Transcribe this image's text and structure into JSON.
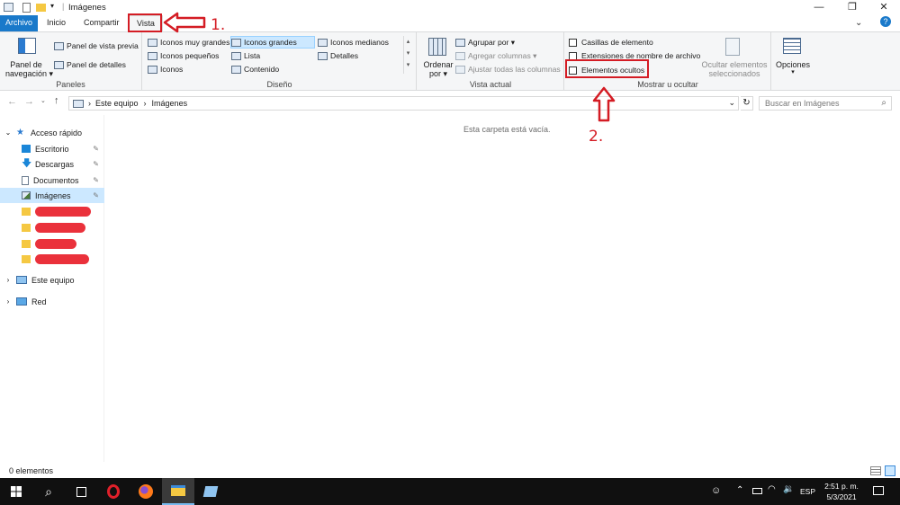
{
  "window": {
    "title": "Imágenes",
    "controls": [
      "—",
      "❐",
      "✕"
    ]
  },
  "tabs": [
    "Archivo",
    "Inicio",
    "Compartir",
    "Vista"
  ],
  "ribbon": {
    "paneles": {
      "label": "Paneles",
      "nav_pane_label_1": "Panel de",
      "nav_pane_label_2": "navegación",
      "preview": "Panel de vista previa",
      "details": "Panel de detalles"
    },
    "diseno": {
      "label": "Diseño",
      "col1": [
        "Iconos muy grandes",
        "Iconos pequeños",
        "Iconos"
      ],
      "col2": [
        "Iconos grandes",
        "Lista",
        "Contenido"
      ],
      "col3": [
        "Iconos medianos",
        "Detalles"
      ]
    },
    "vista_actual": {
      "label": "Vista actual",
      "sort_1": "Ordenar",
      "sort_2": "por",
      "group_by": "Agrupar por",
      "add_columns": "Agregar columnas",
      "fit_columns": "Ajustar todas las columnas"
    },
    "mostrar": {
      "label": "Mostrar u ocultar",
      "item_checkboxes": "Casillas de elemento",
      "file_extensions": "Extensiones de nombre de archivo",
      "hidden_items": "Elementos ocultos",
      "hide_selected_1": "Ocultar elementos",
      "hide_selected_2": "seleccionados"
    },
    "opciones": {
      "label": "Opciones"
    }
  },
  "address": {
    "crumbs": [
      "Este equipo",
      "Imágenes"
    ],
    "search_placeholder": "Buscar en Imágenes"
  },
  "nav": {
    "quick_access": "Acceso rápido",
    "items": [
      "Escritorio",
      "Descargas",
      "Documentos",
      "Imágenes"
    ],
    "this_pc": "Este equipo",
    "network": "Red"
  },
  "content": {
    "empty_message": "Esta carpeta está vacía."
  },
  "status": {
    "count": "0 elementos"
  },
  "annotations": {
    "step1": "1.",
    "step2": "2."
  },
  "taskbar": {
    "time": "2:51 p. m.",
    "date": "5/3/2021",
    "language": "ESP"
  },
  "colors": {
    "archivo_tab": "#1979ca",
    "annotation_red": "#d41c24",
    "selection": "#cce8ff"
  }
}
